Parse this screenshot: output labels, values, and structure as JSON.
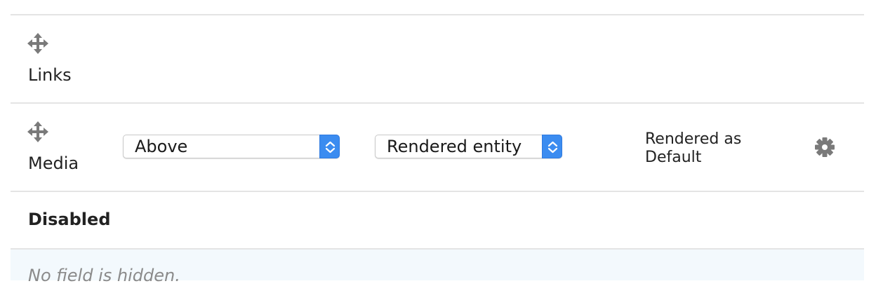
{
  "rows": [
    {
      "label": "Links",
      "handle_icon": "move-arrows-icon"
    },
    {
      "label": "Media",
      "handle_icon": "move-arrows-icon",
      "label_display": "Above",
      "formatter": "Rendered entity",
      "summary_line1": "Rendered as",
      "summary_line2": "Default",
      "settings_icon": "gear-icon"
    }
  ],
  "disabled_region": {
    "title": "Disabled",
    "empty_message": "No field is hidden."
  },
  "colors": {
    "select_button": "#3b8cf0",
    "row_border": "#e4e4e4",
    "empty_row_bg": "#f3f9fd",
    "icon_gray": "#7a7a7a"
  }
}
